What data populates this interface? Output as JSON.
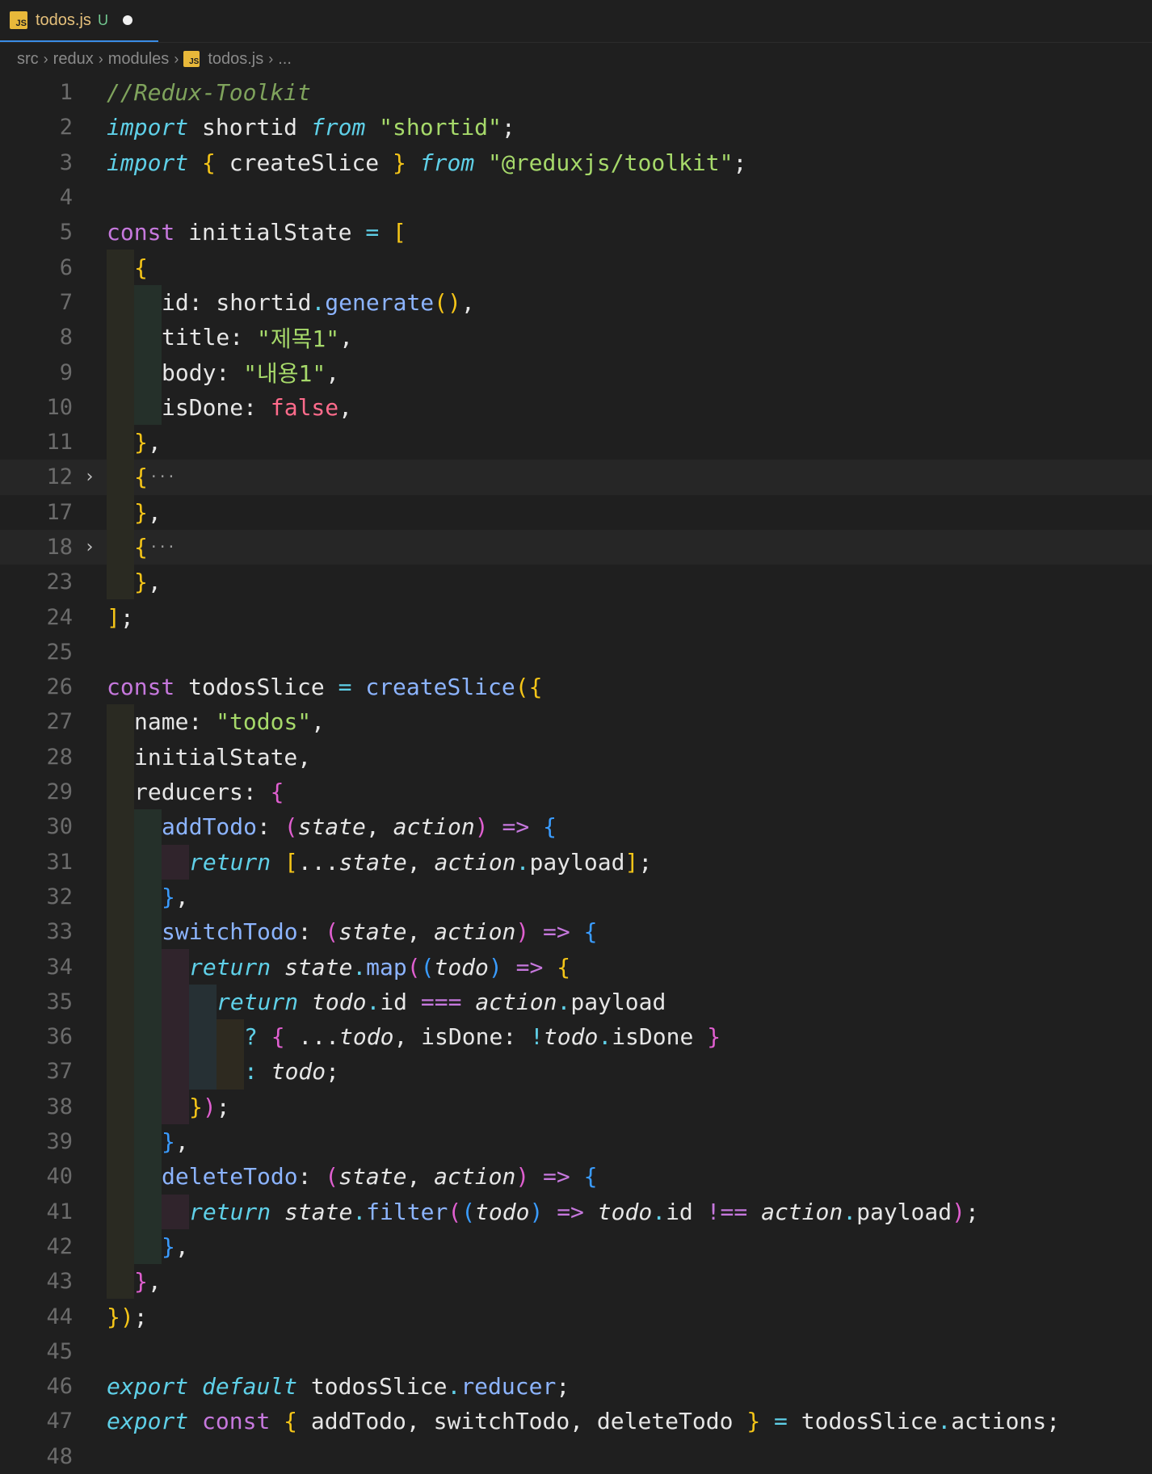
{
  "tab": {
    "icon": "JS",
    "name": "todos.js",
    "status": "U"
  },
  "breadcrumb": [
    "src",
    "redux",
    "modules",
    "todos.js",
    "..."
  ],
  "colors": {
    "keyword": "#c678dd",
    "keyword_italic": "#5fd0e8",
    "string": "#a6d96a",
    "function": "#8cb4ff",
    "comment": "#7fa35c",
    "boolean": "#ff6b8b",
    "bracket_yellow": "#f5c518",
    "bracket_pink": "#e05fd0",
    "bracket_blue": "#3a9cff",
    "plain": "#e6e6e6",
    "param": "#e6e6e6"
  },
  "lines": [
    {
      "n": "1",
      "guides": [],
      "tokens": [
        {
          "t": "//Redux-Toolkit",
          "c": "comment",
          "i": true
        }
      ]
    },
    {
      "n": "2",
      "guides": [],
      "tokens": [
        {
          "t": "import",
          "c": "keyword_italic",
          "i": true
        },
        {
          "t": " shortid ",
          "c": "plain"
        },
        {
          "t": "from",
          "c": "keyword_italic",
          "i": true
        },
        {
          "t": " ",
          "c": "plain"
        },
        {
          "t": "\"shortid\"",
          "c": "string"
        },
        {
          "t": ";",
          "c": "plain"
        }
      ]
    },
    {
      "n": "3",
      "guides": [],
      "tokens": [
        {
          "t": "import",
          "c": "keyword_italic",
          "i": true
        },
        {
          "t": " ",
          "c": "plain"
        },
        {
          "t": "{",
          "c": "bracket_yellow"
        },
        {
          "t": " createSlice ",
          "c": "plain"
        },
        {
          "t": "}",
          "c": "bracket_yellow"
        },
        {
          "t": " ",
          "c": "plain"
        },
        {
          "t": "from",
          "c": "keyword_italic",
          "i": true
        },
        {
          "t": " ",
          "c": "plain"
        },
        {
          "t": "\"@reduxjs/toolkit\"",
          "c": "string"
        },
        {
          "t": ";",
          "c": "plain"
        }
      ]
    },
    {
      "n": "4",
      "guides": [],
      "tokens": []
    },
    {
      "n": "5",
      "guides": [],
      "tokens": [
        {
          "t": "const",
          "c": "keyword"
        },
        {
          "t": " initialState ",
          "c": "plain"
        },
        {
          "t": "=",
          "c": "keyword_italic"
        },
        {
          "t": " ",
          "c": "plain"
        },
        {
          "t": "[",
          "c": "bracket_yellow"
        }
      ]
    },
    {
      "n": "6",
      "guides": [
        "g1"
      ],
      "tokens": [
        {
          "t": "{",
          "c": "bracket_yellow"
        }
      ]
    },
    {
      "n": "7",
      "guides": [
        "g1",
        "g2"
      ],
      "tokens": [
        {
          "t": "id: shortid",
          "c": "plain"
        },
        {
          "t": ".",
          "c": "keyword_italic"
        },
        {
          "t": "generate",
          "c": "function"
        },
        {
          "t": "()",
          "c": "bracket_yellow"
        },
        {
          "t": ",",
          "c": "plain"
        }
      ]
    },
    {
      "n": "8",
      "guides": [
        "g1",
        "g2"
      ],
      "tokens": [
        {
          "t": "title: ",
          "c": "plain"
        },
        {
          "t": "\"제목1\"",
          "c": "string"
        },
        {
          "t": ",",
          "c": "plain"
        }
      ]
    },
    {
      "n": "9",
      "guides": [
        "g1",
        "g2"
      ],
      "tokens": [
        {
          "t": "body: ",
          "c": "plain"
        },
        {
          "t": "\"내용1\"",
          "c": "string"
        },
        {
          "t": ",",
          "c": "plain"
        }
      ]
    },
    {
      "n": "10",
      "guides": [
        "g1",
        "g2"
      ],
      "tokens": [
        {
          "t": "isDone: ",
          "c": "plain"
        },
        {
          "t": "false",
          "c": "boolean"
        },
        {
          "t": ",",
          "c": "plain"
        }
      ]
    },
    {
      "n": "11",
      "guides": [
        "g1"
      ],
      "tokens": [
        {
          "t": "}",
          "c": "bracket_yellow"
        },
        {
          "t": ",",
          "c": "plain"
        }
      ]
    },
    {
      "n": "12",
      "guides": [
        "g1"
      ],
      "fold": "›",
      "hl": true,
      "tokens": [
        {
          "t": "{",
          "c": "bracket_yellow"
        }
      ],
      "ellipsis": "···"
    },
    {
      "n": "17",
      "guides": [
        "g1"
      ],
      "tokens": [
        {
          "t": "}",
          "c": "bracket_yellow"
        },
        {
          "t": ",",
          "c": "plain"
        }
      ]
    },
    {
      "n": "18",
      "guides": [
        "g1"
      ],
      "fold": "›",
      "hl": true,
      "tokens": [
        {
          "t": "{",
          "c": "bracket_yellow"
        }
      ],
      "ellipsis": "···"
    },
    {
      "n": "23",
      "guides": [
        "g1"
      ],
      "tokens": [
        {
          "t": "}",
          "c": "bracket_yellow"
        },
        {
          "t": ",",
          "c": "plain"
        }
      ]
    },
    {
      "n": "24",
      "guides": [],
      "tokens": [
        {
          "t": "]",
          "c": "bracket_yellow"
        },
        {
          "t": ";",
          "c": "plain"
        }
      ]
    },
    {
      "n": "25",
      "guides": [],
      "tokens": []
    },
    {
      "n": "26",
      "guides": [],
      "tokens": [
        {
          "t": "const",
          "c": "keyword"
        },
        {
          "t": " todosSlice ",
          "c": "plain"
        },
        {
          "t": "=",
          "c": "keyword_italic"
        },
        {
          "t": " ",
          "c": "plain"
        },
        {
          "t": "createSlice",
          "c": "function"
        },
        {
          "t": "({",
          "c": "bracket_yellow"
        }
      ]
    },
    {
      "n": "27",
      "guides": [
        "g1"
      ],
      "tokens": [
        {
          "t": "name: ",
          "c": "plain"
        },
        {
          "t": "\"todos\"",
          "c": "string"
        },
        {
          "t": ",",
          "c": "plain"
        }
      ]
    },
    {
      "n": "28",
      "guides": [
        "g1"
      ],
      "tokens": [
        {
          "t": "initialState,",
          "c": "plain"
        }
      ]
    },
    {
      "n": "29",
      "guides": [
        "g1"
      ],
      "tokens": [
        {
          "t": "reducers: ",
          "c": "plain"
        },
        {
          "t": "{",
          "c": "bracket_pink"
        }
      ]
    },
    {
      "n": "30",
      "guides": [
        "g1",
        "g2"
      ],
      "tokens": [
        {
          "t": "addTodo",
          "c": "function"
        },
        {
          "t": ": ",
          "c": "plain"
        },
        {
          "t": "(",
          "c": "bracket_pink"
        },
        {
          "t": "state",
          "c": "param",
          "i": true
        },
        {
          "t": ", ",
          "c": "plain"
        },
        {
          "t": "action",
          "c": "param",
          "i": true
        },
        {
          "t": ")",
          "c": "bracket_pink"
        },
        {
          "t": " ",
          "c": "plain"
        },
        {
          "t": "=>",
          "c": "keyword"
        },
        {
          "t": " ",
          "c": "plain"
        },
        {
          "t": "{",
          "c": "bracket_blue"
        }
      ]
    },
    {
      "n": "31",
      "guides": [
        "g1",
        "g2",
        "g3"
      ],
      "tokens": [
        {
          "t": "return",
          "c": "keyword_italic",
          "i": true
        },
        {
          "t": " ",
          "c": "plain"
        },
        {
          "t": "[",
          "c": "bracket_yellow"
        },
        {
          "t": "...",
          "c": "plain"
        },
        {
          "t": "state",
          "c": "param",
          "i": true
        },
        {
          "t": ", ",
          "c": "plain"
        },
        {
          "t": "action",
          "c": "param",
          "i": true
        },
        {
          "t": ".",
          "c": "keyword_italic"
        },
        {
          "t": "payload",
          "c": "plain"
        },
        {
          "t": "]",
          "c": "bracket_yellow"
        },
        {
          "t": ";",
          "c": "plain"
        }
      ]
    },
    {
      "n": "32",
      "guides": [
        "g1",
        "g2"
      ],
      "tokens": [
        {
          "t": "}",
          "c": "bracket_blue"
        },
        {
          "t": ",",
          "c": "plain"
        }
      ]
    },
    {
      "n": "33",
      "guides": [
        "g1",
        "g2"
      ],
      "tokens": [
        {
          "t": "switchTodo",
          "c": "function"
        },
        {
          "t": ": ",
          "c": "plain"
        },
        {
          "t": "(",
          "c": "bracket_pink"
        },
        {
          "t": "state",
          "c": "param",
          "i": true
        },
        {
          "t": ", ",
          "c": "plain"
        },
        {
          "t": "action",
          "c": "param",
          "i": true
        },
        {
          "t": ")",
          "c": "bracket_pink"
        },
        {
          "t": " ",
          "c": "plain"
        },
        {
          "t": "=>",
          "c": "keyword"
        },
        {
          "t": " ",
          "c": "plain"
        },
        {
          "t": "{",
          "c": "bracket_blue"
        }
      ]
    },
    {
      "n": "34",
      "guides": [
        "g1",
        "g2",
        "g3"
      ],
      "tokens": [
        {
          "t": "return",
          "c": "keyword_italic",
          "i": true
        },
        {
          "t": " ",
          "c": "plain"
        },
        {
          "t": "state",
          "c": "param",
          "i": true
        },
        {
          "t": ".",
          "c": "keyword_italic"
        },
        {
          "t": "map",
          "c": "function"
        },
        {
          "t": "(",
          "c": "bracket_pink"
        },
        {
          "t": "(",
          "c": "bracket_blue"
        },
        {
          "t": "todo",
          "c": "param",
          "i": true
        },
        {
          "t": ")",
          "c": "bracket_blue"
        },
        {
          "t": " ",
          "c": "plain"
        },
        {
          "t": "=>",
          "c": "keyword"
        },
        {
          "t": " ",
          "c": "plain"
        },
        {
          "t": "{",
          "c": "bracket_yellow"
        }
      ]
    },
    {
      "n": "35",
      "guides": [
        "g1",
        "g2",
        "g3",
        "g4"
      ],
      "tokens": [
        {
          "t": "return",
          "c": "keyword_italic",
          "i": true
        },
        {
          "t": " ",
          "c": "plain"
        },
        {
          "t": "todo",
          "c": "param",
          "i": true
        },
        {
          "t": ".",
          "c": "keyword_italic"
        },
        {
          "t": "id ",
          "c": "plain"
        },
        {
          "t": "===",
          "c": "keyword"
        },
        {
          "t": " ",
          "c": "plain"
        },
        {
          "t": "action",
          "c": "param",
          "i": true
        },
        {
          "t": ".",
          "c": "keyword_italic"
        },
        {
          "t": "payload",
          "c": "plain"
        }
      ]
    },
    {
      "n": "36",
      "guides": [
        "g1",
        "g2",
        "g3",
        "g4",
        "g5"
      ],
      "tokens": [
        {
          "t": "? ",
          "c": "keyword_italic"
        },
        {
          "t": "{",
          "c": "bracket_pink"
        },
        {
          "t": " ...",
          "c": "plain"
        },
        {
          "t": "todo",
          "c": "param",
          "i": true
        },
        {
          "t": ", isDone: ",
          "c": "plain"
        },
        {
          "t": "!",
          "c": "keyword_italic"
        },
        {
          "t": "todo",
          "c": "param",
          "i": true
        },
        {
          "t": ".",
          "c": "keyword_italic"
        },
        {
          "t": "isDone ",
          "c": "plain"
        },
        {
          "t": "}",
          "c": "bracket_pink"
        }
      ]
    },
    {
      "n": "37",
      "guides": [
        "g1",
        "g2",
        "g3",
        "g4",
        "g5"
      ],
      "tokens": [
        {
          "t": ": ",
          "c": "keyword_italic"
        },
        {
          "t": "todo",
          "c": "param",
          "i": true
        },
        {
          "t": ";",
          "c": "plain"
        }
      ]
    },
    {
      "n": "38",
      "guides": [
        "g1",
        "g2",
        "g3"
      ],
      "tokens": [
        {
          "t": "}",
          "c": "bracket_yellow"
        },
        {
          "t": ")",
          "c": "bracket_pink"
        },
        {
          "t": ";",
          "c": "plain"
        }
      ]
    },
    {
      "n": "39",
      "guides": [
        "g1",
        "g2"
      ],
      "tokens": [
        {
          "t": "}",
          "c": "bracket_blue"
        },
        {
          "t": ",",
          "c": "plain"
        }
      ]
    },
    {
      "n": "40",
      "guides": [
        "g1",
        "g2"
      ],
      "tokens": [
        {
          "t": "deleteTodo",
          "c": "function"
        },
        {
          "t": ": ",
          "c": "plain"
        },
        {
          "t": "(",
          "c": "bracket_pink"
        },
        {
          "t": "state",
          "c": "param",
          "i": true
        },
        {
          "t": ", ",
          "c": "plain"
        },
        {
          "t": "action",
          "c": "param",
          "i": true
        },
        {
          "t": ")",
          "c": "bracket_pink"
        },
        {
          "t": " ",
          "c": "plain"
        },
        {
          "t": "=>",
          "c": "keyword"
        },
        {
          "t": " ",
          "c": "plain"
        },
        {
          "t": "{",
          "c": "bracket_blue"
        }
      ]
    },
    {
      "n": "41",
      "guides": [
        "g1",
        "g2",
        "g3"
      ],
      "tokens": [
        {
          "t": "return",
          "c": "keyword_italic",
          "i": true
        },
        {
          "t": " ",
          "c": "plain"
        },
        {
          "t": "state",
          "c": "param",
          "i": true
        },
        {
          "t": ".",
          "c": "keyword_italic"
        },
        {
          "t": "filter",
          "c": "function"
        },
        {
          "t": "(",
          "c": "bracket_pink"
        },
        {
          "t": "(",
          "c": "bracket_blue"
        },
        {
          "t": "todo",
          "c": "param",
          "i": true
        },
        {
          "t": ")",
          "c": "bracket_blue"
        },
        {
          "t": " ",
          "c": "plain"
        },
        {
          "t": "=>",
          "c": "keyword"
        },
        {
          "t": " ",
          "c": "plain"
        },
        {
          "t": "todo",
          "c": "param",
          "i": true
        },
        {
          "t": ".",
          "c": "keyword_italic"
        },
        {
          "t": "id ",
          "c": "plain"
        },
        {
          "t": "!==",
          "c": "keyword"
        },
        {
          "t": " ",
          "c": "plain"
        },
        {
          "t": "action",
          "c": "param",
          "i": true
        },
        {
          "t": ".",
          "c": "keyword_italic"
        },
        {
          "t": "payload",
          "c": "plain"
        },
        {
          "t": ")",
          "c": "bracket_pink"
        },
        {
          "t": ";",
          "c": "plain"
        }
      ]
    },
    {
      "n": "42",
      "guides": [
        "g1",
        "g2"
      ],
      "tokens": [
        {
          "t": "}",
          "c": "bracket_blue"
        },
        {
          "t": ",",
          "c": "plain"
        }
      ]
    },
    {
      "n": "43",
      "guides": [
        "g1"
      ],
      "tokens": [
        {
          "t": "}",
          "c": "bracket_pink"
        },
        {
          "t": ",",
          "c": "plain"
        }
      ]
    },
    {
      "n": "44",
      "guides": [],
      "tokens": [
        {
          "t": "})",
          "c": "bracket_yellow"
        },
        {
          "t": ";",
          "c": "plain"
        }
      ]
    },
    {
      "n": "45",
      "guides": [],
      "tokens": []
    },
    {
      "n": "46",
      "guides": [],
      "tokens": [
        {
          "t": "export",
          "c": "keyword_italic",
          "i": true
        },
        {
          "t": " ",
          "c": "plain"
        },
        {
          "t": "default",
          "c": "keyword_italic",
          "i": true
        },
        {
          "t": " todosSlice",
          "c": "plain"
        },
        {
          "t": ".",
          "c": "keyword_italic"
        },
        {
          "t": "reducer",
          "c": "function"
        },
        {
          "t": ";",
          "c": "plain"
        }
      ]
    },
    {
      "n": "47",
      "guides": [],
      "tokens": [
        {
          "t": "export",
          "c": "keyword_italic",
          "i": true
        },
        {
          "t": " ",
          "c": "plain"
        },
        {
          "t": "const",
          "c": "keyword"
        },
        {
          "t": " ",
          "c": "plain"
        },
        {
          "t": "{",
          "c": "bracket_yellow"
        },
        {
          "t": " addTodo, switchTodo, deleteTodo ",
          "c": "plain"
        },
        {
          "t": "}",
          "c": "bracket_yellow"
        },
        {
          "t": " ",
          "c": "plain"
        },
        {
          "t": "=",
          "c": "keyword_italic"
        },
        {
          "t": " todosSlice",
          "c": "plain"
        },
        {
          "t": ".",
          "c": "keyword_italic"
        },
        {
          "t": "actions",
          "c": "plain"
        },
        {
          "t": ";",
          "c": "plain"
        }
      ]
    },
    {
      "n": "48",
      "guides": [],
      "tokens": []
    }
  ]
}
